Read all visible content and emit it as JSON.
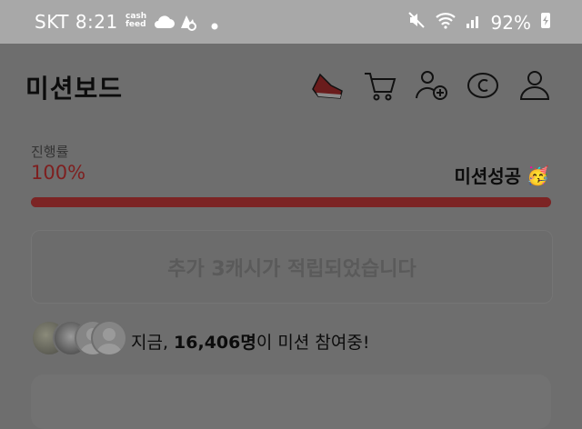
{
  "status_bar": {
    "carrier_time": "SKT 8:21",
    "cashfeed_label": "cash\nfeed",
    "battery": "92%",
    "icons": [
      "cashfeed-icon",
      "cloud-icon",
      "app-icon",
      "dot-icon",
      "mute-icon",
      "wifi-icon",
      "signal-icon",
      "battery-charging-icon"
    ]
  },
  "header": {
    "title": "미션보드",
    "icons": [
      "shoe-icon",
      "cart-icon",
      "add-friend-icon",
      "cash-icon",
      "profile-icon"
    ]
  },
  "progress": {
    "label": "진행률",
    "value_text": "100%",
    "value": 1.0,
    "status": "미션성공",
    "status_emoji": "🥳"
  },
  "reward": {
    "message": "추가 3캐시가 적립되었습니다"
  },
  "participants": {
    "prefix": "지금, ",
    "count": "16,406명",
    "suffix": "이 미션 참여중!"
  },
  "colors": {
    "accent": "#7c2424",
    "status_bar": "#a8a8a8",
    "overlay_bg": "#6e6e6e"
  }
}
